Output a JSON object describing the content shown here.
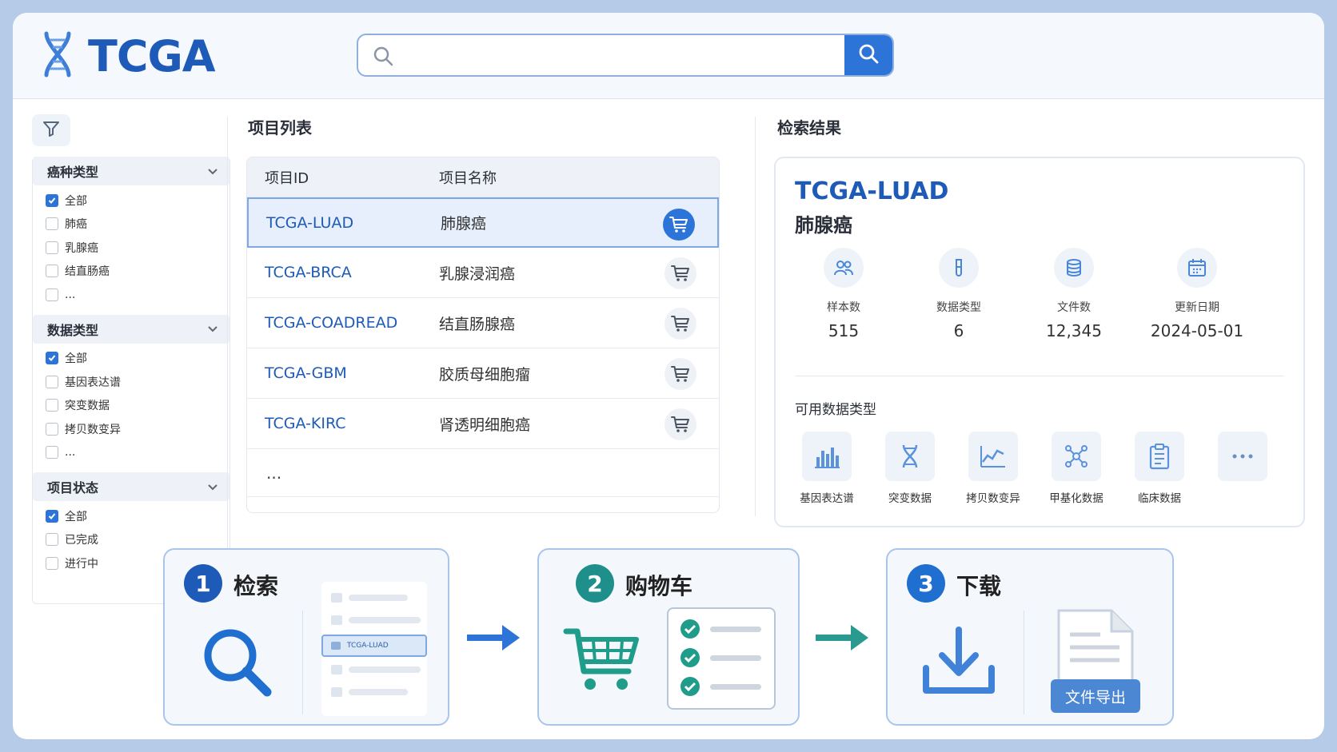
{
  "header": {
    "logo_text": "TCGA",
    "search_placeholder": ""
  },
  "filters": {
    "groups": [
      {
        "title": "癌种类型",
        "items": [
          {
            "label": "全部",
            "checked": true
          },
          {
            "label": "肺癌",
            "checked": false
          },
          {
            "label": "乳腺癌",
            "checked": false
          },
          {
            "label": "结直肠癌",
            "checked": false
          },
          {
            "label": "...",
            "checked": false
          }
        ]
      },
      {
        "title": "数据类型",
        "items": [
          {
            "label": "全部",
            "checked": true
          },
          {
            "label": "基因表达谱",
            "checked": false
          },
          {
            "label": "突变数据",
            "checked": false
          },
          {
            "label": "拷贝数变异",
            "checked": false
          },
          {
            "label": "...",
            "checked": false
          }
        ]
      },
      {
        "title": "项目状态",
        "items": [
          {
            "label": "全部",
            "checked": true
          },
          {
            "label": "已完成",
            "checked": false
          },
          {
            "label": "进行中",
            "checked": false
          }
        ]
      }
    ]
  },
  "project_list": {
    "title": "项目列表",
    "col_id": "项目ID",
    "col_name": "项目名称",
    "rows": [
      {
        "id": "TCGA-LUAD",
        "name": "肺腺癌",
        "selected": true
      },
      {
        "id": "TCGA-BRCA",
        "name": "乳腺浸润癌",
        "selected": false
      },
      {
        "id": "TCGA-COADREAD",
        "name": "结直肠腺癌",
        "selected": false
      },
      {
        "id": "TCGA-GBM",
        "name": "胶质母细胞瘤",
        "selected": false
      },
      {
        "id": "TCGA-KIRC",
        "name": "肾透明细胞癌",
        "selected": false
      }
    ],
    "more": "..."
  },
  "result": {
    "section_title": "检索结果",
    "project_id": "TCGA-LUAD",
    "project_name": "肺腺癌",
    "stats": [
      {
        "label": "样本数",
        "value": "515",
        "icon": "people-icon"
      },
      {
        "label": "数据类型",
        "value": "6",
        "icon": "test-tube-icon"
      },
      {
        "label": "文件数",
        "value": "12,345",
        "icon": "database-icon"
      },
      {
        "label": "更新日期",
        "value": "2024-05-01",
        "icon": "calendar-icon"
      }
    ],
    "available_title": "可用数据类型",
    "data_types": [
      {
        "label": "基因表达谱",
        "icon": "bar-chart-icon"
      },
      {
        "label": "突变数据",
        "icon": "dna-icon"
      },
      {
        "label": "拷贝数变异",
        "icon": "line-chart-icon"
      },
      {
        "label": "甲基化数据",
        "icon": "molecule-icon"
      },
      {
        "label": "临床数据",
        "icon": "clipboard-icon"
      },
      {
        "label": "",
        "icon": "more-icon"
      }
    ]
  },
  "workflow": {
    "steps": [
      {
        "num": "1",
        "label": "检索",
        "mini_selected": "TCGA-LUAD"
      },
      {
        "num": "2",
        "label": "购物车"
      },
      {
        "num": "3",
        "label": "下载",
        "export_label": "文件导出"
      }
    ]
  },
  "colors": {
    "primary": "#1e5bb8",
    "accent": "#2d74d8",
    "teal": "#1f8f8c",
    "check_green": "#1f9c8a"
  }
}
